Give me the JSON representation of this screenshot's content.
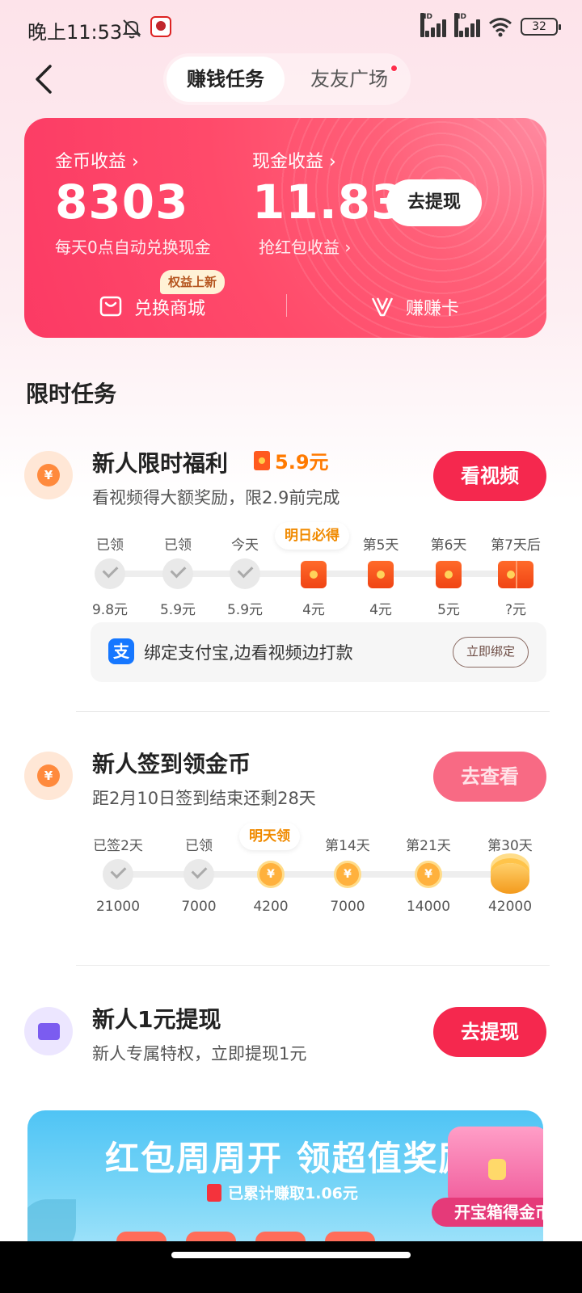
{
  "status_bar": {
    "time": "晚上11:53",
    "signal_label_1": "HD",
    "signal_label_2": "HD",
    "battery": "32"
  },
  "header": {
    "tabs": [
      {
        "label": "赚钱任务",
        "active": true
      },
      {
        "label": "友友广场",
        "active": false,
        "has_dot": true
      }
    ]
  },
  "earnings": {
    "coin_label": "金币收益 ›",
    "coin_value": "8303",
    "coin_sub": "每天0点自动兑换现金",
    "cash_label": "现金收益 ›",
    "cash_value": "11.83",
    "cash_sub": "抢红包收益 ›",
    "withdraw_button": "去提现",
    "mall_label": "兑换商城",
    "mall_badge": "权益上新",
    "card_label": "赚赚卡"
  },
  "section": {
    "title": "限时任务"
  },
  "tasks": [
    {
      "title": "新人限时福利",
      "reward": "5.9元",
      "desc": "看视频得大额奖励，限2.9前完成",
      "button": "看视频",
      "days": [
        {
          "label": "已领",
          "amount": "9.8元",
          "state": "done"
        },
        {
          "label": "已领",
          "amount": "5.9元",
          "state": "done"
        },
        {
          "label": "今天",
          "amount": "5.9元",
          "state": "done"
        },
        {
          "label": "明日必得",
          "amount": "4元",
          "state": "highlight"
        },
        {
          "label": "第5天",
          "amount": "4元",
          "state": "pending"
        },
        {
          "label": "第6天",
          "amount": "5元",
          "state": "pending"
        },
        {
          "label": "第7天后",
          "amount": "?元",
          "state": "pending-double"
        }
      ],
      "alipay": {
        "icon": "支",
        "text": "绑定支付宝,边看视频边打款",
        "button": "立即绑定"
      }
    },
    {
      "title": "新人签到领金币",
      "desc": "距2月10日签到结束还剩28天",
      "button": "去查看",
      "days": [
        {
          "label": "已签2天",
          "amount": "21000",
          "state": "done"
        },
        {
          "label": "已领",
          "amount": "7000",
          "state": "done"
        },
        {
          "label": "明天领",
          "amount": "4200",
          "state": "highlight"
        },
        {
          "label": "第14天",
          "amount": "7000",
          "state": "pending"
        },
        {
          "label": "第21天",
          "amount": "14000",
          "state": "pending"
        },
        {
          "label": "第30天",
          "amount": "42000",
          "state": "stack"
        }
      ]
    },
    {
      "title": "新人1元提现",
      "desc": "新人专属特权，立即提现1元",
      "button": "去提现"
    }
  ],
  "banner": {
    "title": "红包周周开 领超值奖励",
    "sub": "已累计赚取1.06元",
    "chest_tag": "开宝箱得金币"
  },
  "colors": {
    "accent": "#f5284e",
    "card_bg": "#ff4a6a",
    "reward_orange": "#ff7a00",
    "alipay_blue": "#1677ff"
  }
}
